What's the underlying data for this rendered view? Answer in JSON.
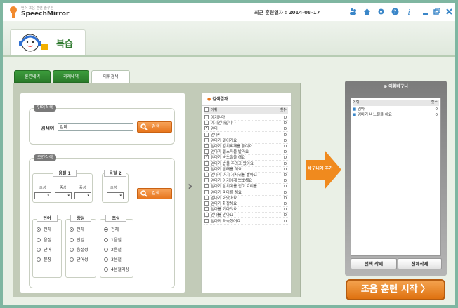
{
  "app": {
    "subtitle": "언어 조음 훈련 솔루션",
    "name": "SpeechMirror",
    "last_training": "최근 훈련일자 : 2014-08-17"
  },
  "header": {
    "title": "복습"
  },
  "tabs": [
    {
      "label": "훈련내역"
    },
    {
      "label": "과제내역"
    },
    {
      "label": "어휘검색"
    }
  ],
  "search_word": {
    "section": "단어검색",
    "label": "검색어",
    "value": "엄마",
    "button": "검색"
  },
  "search_cond": {
    "section": "조건검색",
    "syll1": "음절 1",
    "syll2": "음절 2",
    "labels": [
      "초성",
      "중성",
      "종성"
    ],
    "button": "검색",
    "word_group": {
      "title": "단어",
      "options": [
        "전체",
        "음절",
        "단어",
        "문장"
      ]
    },
    "vowel_group": {
      "title": "중성",
      "options": [
        "전체",
        "단일",
        "음절성",
        "단어성"
      ]
    },
    "initial_group": {
      "title": "초성",
      "options": [
        "전체",
        "1음절",
        "2음절",
        "3음절",
        "4음절이상"
      ]
    }
  },
  "results": {
    "title": "검색결과",
    "col_word": "어휘",
    "col_count": "횟수",
    "rows": [
      {
        "w": "아기엄마",
        "c": "0",
        "chk": false
      },
      {
        "w": "아기엄마입니다",
        "c": "0",
        "chk": false
      },
      {
        "w": "엄마",
        "c": "0",
        "chk": true
      },
      {
        "w": "엄마*",
        "c": "0",
        "chk": false
      },
      {
        "w": "엄마가 걸어가요",
        "c": "0",
        "chk": false
      },
      {
        "w": "엄마가 김치찌개를 끓여요",
        "c": "0",
        "chk": false
      },
      {
        "w": "엄마가 립스틱을 발라요",
        "c": "0",
        "chk": false
      },
      {
        "w": "엄마가 바느질을 해요",
        "c": "0",
        "chk": true
      },
      {
        "w": "엄마가 밥을 주려고 왔어요",
        "c": "0",
        "chk": false
      },
      {
        "w": "엄마가 빨래를 해요",
        "c": "0",
        "chk": false
      },
      {
        "w": "엄마가 아기 기저귀를 빨아요",
        "c": "0",
        "chk": false
      },
      {
        "w": "엄마가 아기에게 뽀뽀해요",
        "c": "0",
        "chk": false
      },
      {
        "w": "엄마가 앞치마를 입고 요리를...",
        "c": "0",
        "chk": false
      },
      {
        "w": "엄마가 파마를 해요",
        "c": "0",
        "chk": false
      },
      {
        "w": "엄마가 화났어요",
        "c": "0",
        "chk": false
      },
      {
        "w": "엄마가 화장해요",
        "c": "0",
        "chk": false
      },
      {
        "w": "엄마를 기다려요",
        "c": "0",
        "chk": false
      },
      {
        "w": "엄마를 안아요",
        "c": "0",
        "chk": false
      },
      {
        "w": "엄마와 약속했어요",
        "c": "0",
        "chk": false
      }
    ]
  },
  "add_button": "바구니에 추가",
  "basket": {
    "title": "어휘바구니",
    "col_word": "어휘",
    "col_count": "횟수",
    "items": [
      {
        "w": "엄마",
        "c": "0"
      },
      {
        "w": "엄마가 바느질을 해요",
        "c": "0"
      }
    ],
    "delete_selected": "선택 삭제",
    "delete_all": "전체삭제"
  },
  "start_button": "조음 훈련 시작 〉",
  "colors": {
    "accent": "#e7761e",
    "green": "#2a7a2a",
    "frame": "#7fb6a1"
  }
}
